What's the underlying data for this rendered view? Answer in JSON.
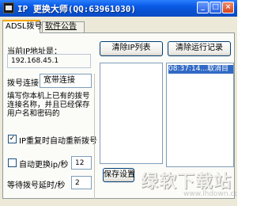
{
  "window": {
    "title": "IP 更换大师(QQ:63961030)",
    "minimize": "_",
    "maximize": "□",
    "close": "×"
  },
  "tabs": [
    {
      "label": "ADSL拨号",
      "active": true
    },
    {
      "label": "软件公告",
      "active": false
    }
  ],
  "adsl": {
    "current_ip_label": "当前IP地址是：",
    "current_ip_value": "192.168.45.1",
    "connection_label": "拨号连接",
    "connection_value": "宽带连接",
    "hint_text": "填写你本机上已有的拨号连接名称，并且已经保存用户名和密码的",
    "auto_redial_label": "IP重复时自动重新拨号",
    "auto_redial_checked": true,
    "auto_change_label": "自动更换ip/秒",
    "auto_change_checked": false,
    "auto_change_value": "12",
    "wait_label": "等待拨号延时/秒",
    "wait_value": "2"
  },
  "buttons": {
    "clear_ip_list": "清除IP列表",
    "clear_run_log": "清除运行记录",
    "save_settings": "保存设置"
  },
  "log": {
    "entries": [
      "08:37:14...取消目"
    ]
  },
  "watermark": {
    "logo": "绿软下载站",
    "url": "www.lhdown.com"
  },
  "colors": {
    "titlebar": "#0a5ce6",
    "window_bg": "#ece9d8",
    "selection": "#316ac5",
    "check_mark": "#21a121"
  }
}
